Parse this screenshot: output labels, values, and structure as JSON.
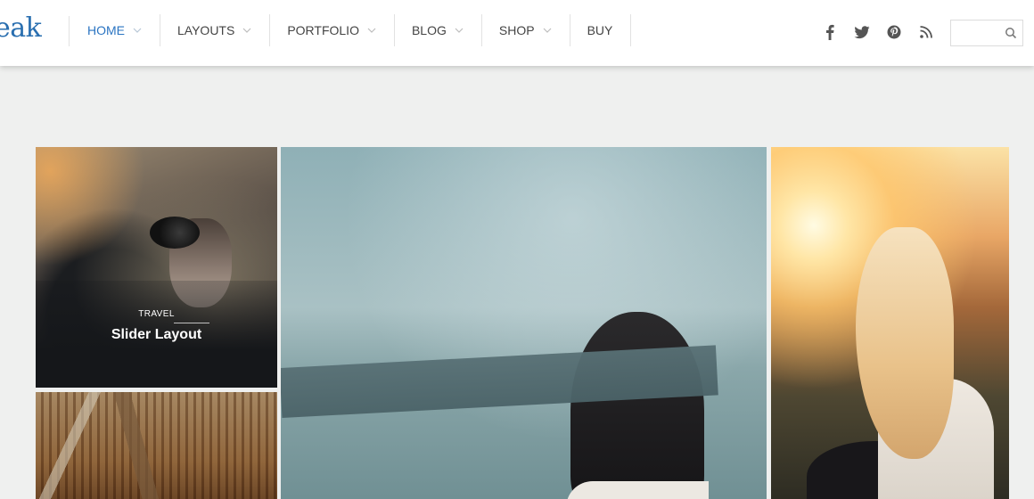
{
  "header": {
    "logo_text": "eak",
    "nav": [
      {
        "label": "HOME",
        "active": true,
        "has_dropdown": true
      },
      {
        "label": "LAYOUTS",
        "active": false,
        "has_dropdown": true
      },
      {
        "label": "PORTFOLIO",
        "active": false,
        "has_dropdown": true
      },
      {
        "label": "BLOG",
        "active": false,
        "has_dropdown": true
      },
      {
        "label": "SHOP",
        "active": false,
        "has_dropdown": true
      },
      {
        "label": "BUY",
        "active": false,
        "has_dropdown": false
      }
    ],
    "social_icons": [
      "facebook-icon",
      "twitter-icon",
      "pinterest-icon",
      "rss-icon"
    ],
    "search": {
      "value": "",
      "placeholder": ""
    }
  },
  "gallery": {
    "tiles": [
      {
        "category": "TRAVEL",
        "title": "Slider Layout"
      }
    ]
  },
  "colors": {
    "accent": "#2a74c2",
    "page_bg": "#eff0ef",
    "header_bg": "#ffffff"
  }
}
